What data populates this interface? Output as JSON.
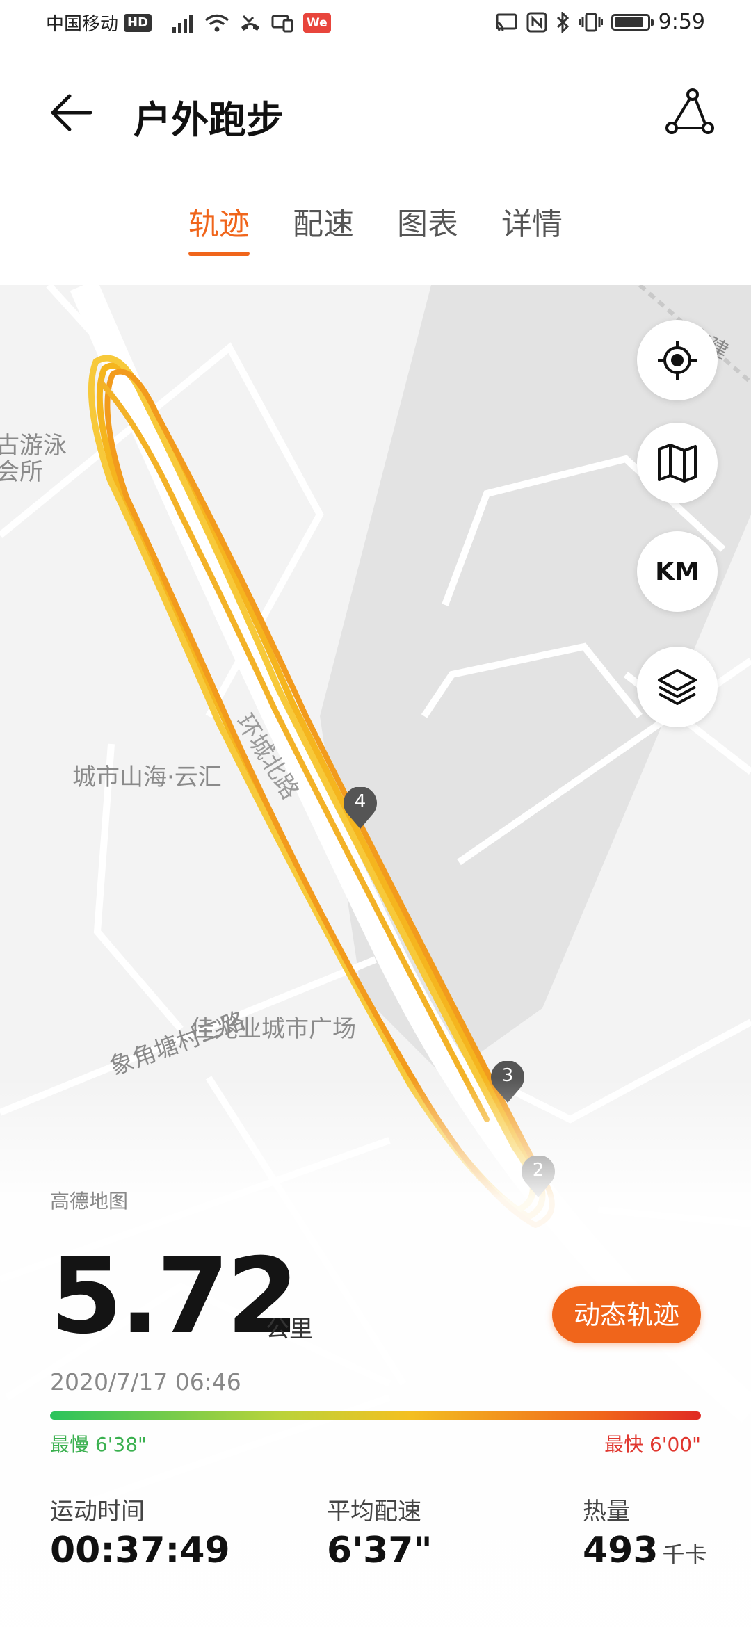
{
  "status_bar": {
    "carrier": "中国移动",
    "hd_badge": "HD",
    "we_badge": "We",
    "time": "9:59",
    "battery_level": 0.9
  },
  "header": {
    "title": "户外跑步"
  },
  "tabs": [
    {
      "label": "轨迹",
      "active": true
    },
    {
      "label": "配速",
      "active": false
    },
    {
      "label": "图表",
      "active": false
    },
    {
      "label": "详情",
      "active": false
    }
  ],
  "map": {
    "labels": {
      "swim_club_1": "古游泳",
      "swim_club_2": "会所",
      "road_huancheng": "环城北路",
      "city_shanhai": "城市山海·云汇",
      "xiangjiaotang_2": "象角塘村二路",
      "jiazhaoye": "佳兆业城市广场",
      "dongjian": "东建"
    },
    "markers": [
      "4",
      "3",
      "2"
    ],
    "controls": {
      "km_label": "KM"
    },
    "provider": "高德地图"
  },
  "summary": {
    "distance": "5.72",
    "distance_unit": "公里",
    "datetime": "2020/7/17 06:46",
    "dynamic_track_button": "动态轨迹",
    "pace_slowest": "最慢 6'38\"",
    "pace_fastest": "最快 6'00\""
  },
  "stats": [
    {
      "label": "运动时间",
      "value": "00:37:49",
      "unit": ""
    },
    {
      "label": "平均配速",
      "value": "6'37\"",
      "unit": ""
    },
    {
      "label": "热量",
      "value": "493",
      "unit": "千卡"
    }
  ],
  "colors": {
    "accent": "#f0651b",
    "track": "#f5b51e",
    "slow": "#3ab04f",
    "fast": "#e0372f"
  }
}
